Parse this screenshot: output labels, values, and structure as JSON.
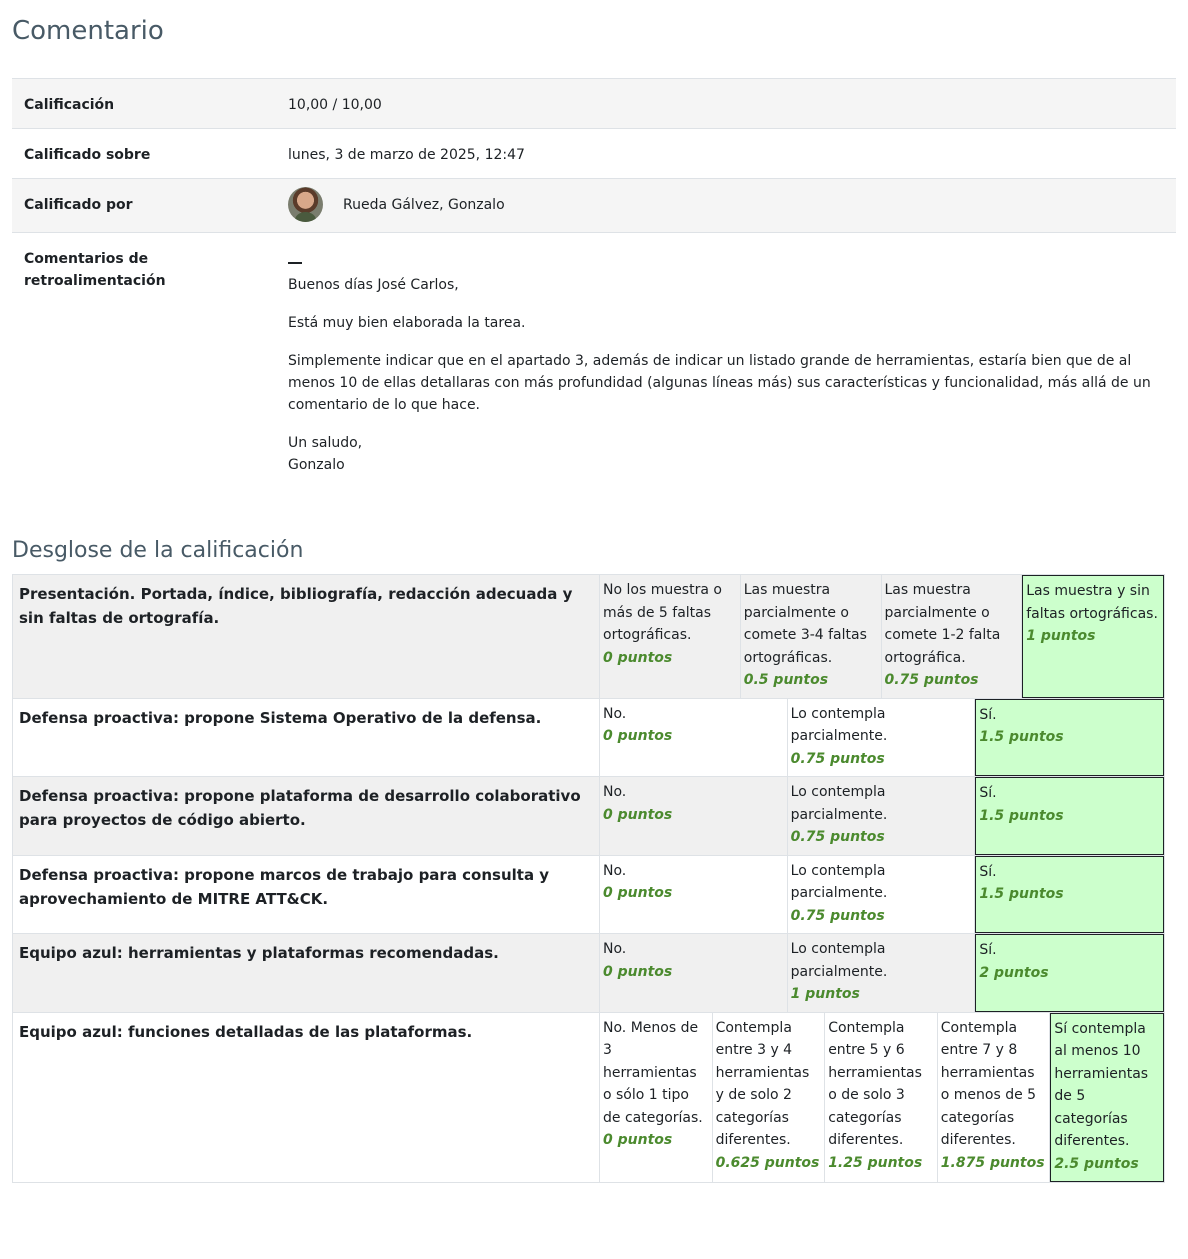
{
  "comentario": {
    "heading": "Comentario",
    "rows": {
      "calificacion": {
        "label": "Calificación",
        "value": "10,00 / 10,00"
      },
      "calificado_sobre": {
        "label": "Calificado sobre",
        "value": "lunes, 3 de marzo de 2025, 12:47"
      },
      "calificado_por": {
        "label": "Calificado por",
        "value": "Rueda Gálvez, Gonzalo"
      },
      "comentarios": {
        "label": "Comentarios de retroalimentación",
        "paragraphs": [
          "Buenos días José Carlos,",
          "Está muy bien elaborada la tarea.",
          "Simplemente indicar que en el apartado 3, además de indicar un listado grande de herramientas, estaría bien que de al menos 10 de ellas detallaras con más profundidad (algunas líneas más) sus características y funcionalidad, más allá de un comentario de lo que hace.",
          "Un saludo,",
          "Gonzalo"
        ]
      }
    }
  },
  "desglose": {
    "heading": "Desglose de la calificación",
    "criteria": [
      {
        "name": "Presentación. Portada, índice, bibliografía, redacción adecuada y sin faltas de ortografía.",
        "levels": [
          {
            "definition": "No los muestra o más de 5 faltas ortográficas.",
            "score": "0 puntos",
            "checked": false
          },
          {
            "definition": "Las muestra parcialmente o comete 3-4 faltas ortográficas.",
            "score": "0.5 puntos",
            "checked": false
          },
          {
            "definition": "Las muestra parcialmente o comete 1-2 falta ortográfica.",
            "score": "0.75 puntos",
            "checked": false
          },
          {
            "definition": "Las muestra y sin faltas ortográficas.",
            "score": "1 puntos",
            "checked": true
          }
        ]
      },
      {
        "name": "Defensa proactiva: propone Sistema Operativo de la defensa.",
        "levels": [
          {
            "definition": "No.",
            "score": "0 puntos",
            "checked": false
          },
          {
            "definition": "Lo contempla parcialmente.",
            "score": "0.75 puntos",
            "checked": false
          },
          {
            "definition": "Sí.",
            "score": "1.5 puntos",
            "checked": true
          }
        ]
      },
      {
        "name": "Defensa proactiva: propone plataforma de desarrollo colaborativo para proyectos de código abierto.",
        "levels": [
          {
            "definition": "No.",
            "score": "0 puntos",
            "checked": false
          },
          {
            "definition": "Lo contempla parcialmente.",
            "score": "0.75 puntos",
            "checked": false
          },
          {
            "definition": "Sí.",
            "score": "1.5 puntos",
            "checked": true
          }
        ]
      },
      {
        "name": "Defensa proactiva: propone marcos de trabajo para consulta y aprovechamiento de MITRE ATT&CK.",
        "levels": [
          {
            "definition": "No.",
            "score": "0 puntos",
            "checked": false
          },
          {
            "definition": "Lo contempla parcialmente.",
            "score": "0.75 puntos",
            "checked": false
          },
          {
            "definition": "Sí.",
            "score": "1.5 puntos",
            "checked": true
          }
        ]
      },
      {
        "name": "Equipo azul: herramientas y plataformas recomendadas.",
        "levels": [
          {
            "definition": "No.",
            "score": "0 puntos",
            "checked": false
          },
          {
            "definition": "Lo contempla parcialmente.",
            "score": "1 puntos",
            "checked": false
          },
          {
            "definition": "Sí.",
            "score": "2 puntos",
            "checked": true
          }
        ]
      },
      {
        "name": "Equipo azul: funciones detalladas de las plataformas.",
        "levels": [
          {
            "definition": "No. Menos de 3 herramientas o sólo 1 tipo de categorías.",
            "score": "0 puntos",
            "checked": false
          },
          {
            "definition": "Contempla entre 3 y 4 herramientas y de solo 2 categorías diferentes.",
            "score": "0.625 puntos",
            "checked": false
          },
          {
            "definition": "Contempla entre 5 y 6 herramientas o de solo 3 categorías diferentes.",
            "score": "1.25 puntos",
            "checked": false
          },
          {
            "definition": "Contempla entre 7 y 8 herramientas o menos de 5 categorías diferentes.",
            "score": "1.875 puntos",
            "checked": false
          },
          {
            "definition": "Sí contempla al menos 10 herramientas de 5 categorías diferentes.",
            "score": "2.5 puntos",
            "checked": true
          }
        ]
      }
    ]
  }
}
